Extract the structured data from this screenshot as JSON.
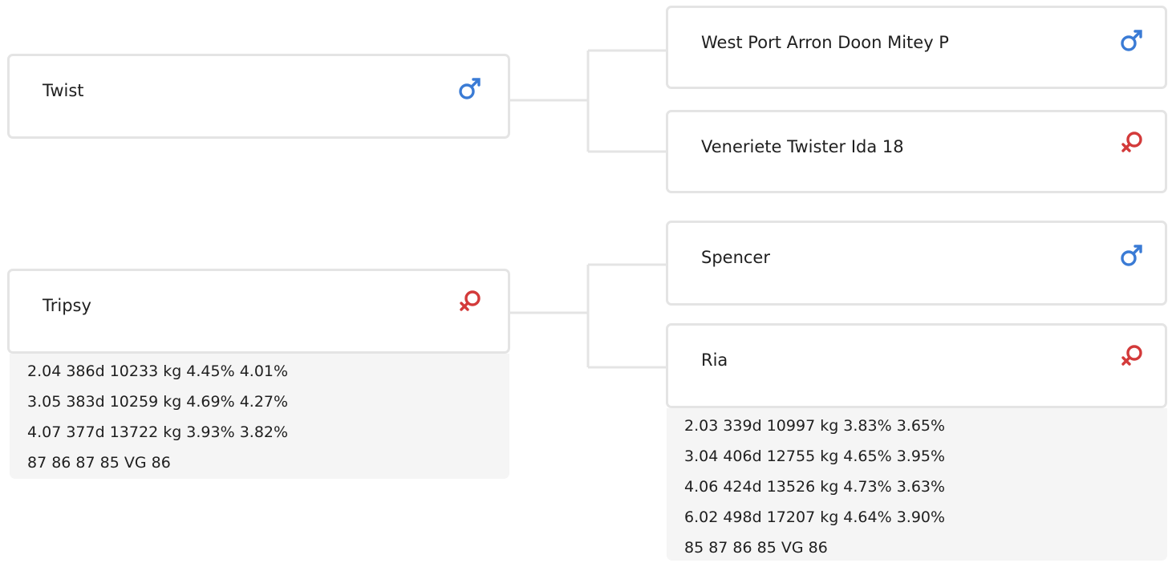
{
  "icons": {
    "male": {
      "name": "male-icon",
      "color": "#3a7bd5"
    },
    "female": {
      "name": "female-icon",
      "color": "#d33a3a"
    }
  },
  "animal_1": {
    "name": "Twist",
    "sex": "male",
    "sire": {
      "name": "West Port Arron Doon Mitey P",
      "sex": "male"
    },
    "dam": {
      "name": "Veneriete Twister Ida 18",
      "sex": "female"
    }
  },
  "animal_2": {
    "name": "Tripsy",
    "sex": "female",
    "stats": [
      "2.04 386d 10233 kg 4.45% 4.01%",
      "3.05 383d 10259 kg 4.69% 4.27%",
      "4.07 377d 13722 kg 3.93% 3.82%",
      "87 86 87 85 VG 86"
    ],
    "sire": {
      "name": "Spencer",
      "sex": "male"
    },
    "dam": {
      "name": "Ria",
      "sex": "female",
      "stats": [
        "2.03 339d 10997 kg 3.83% 3.65%",
        "3.04 406d 12755 kg 4.65% 3.95%",
        "4.06 424d 13526 kg 4.73% 3.63%",
        "6.02 498d 17207 kg 4.64% 3.90%",
        "85 87 86 85 VG 86"
      ]
    }
  }
}
